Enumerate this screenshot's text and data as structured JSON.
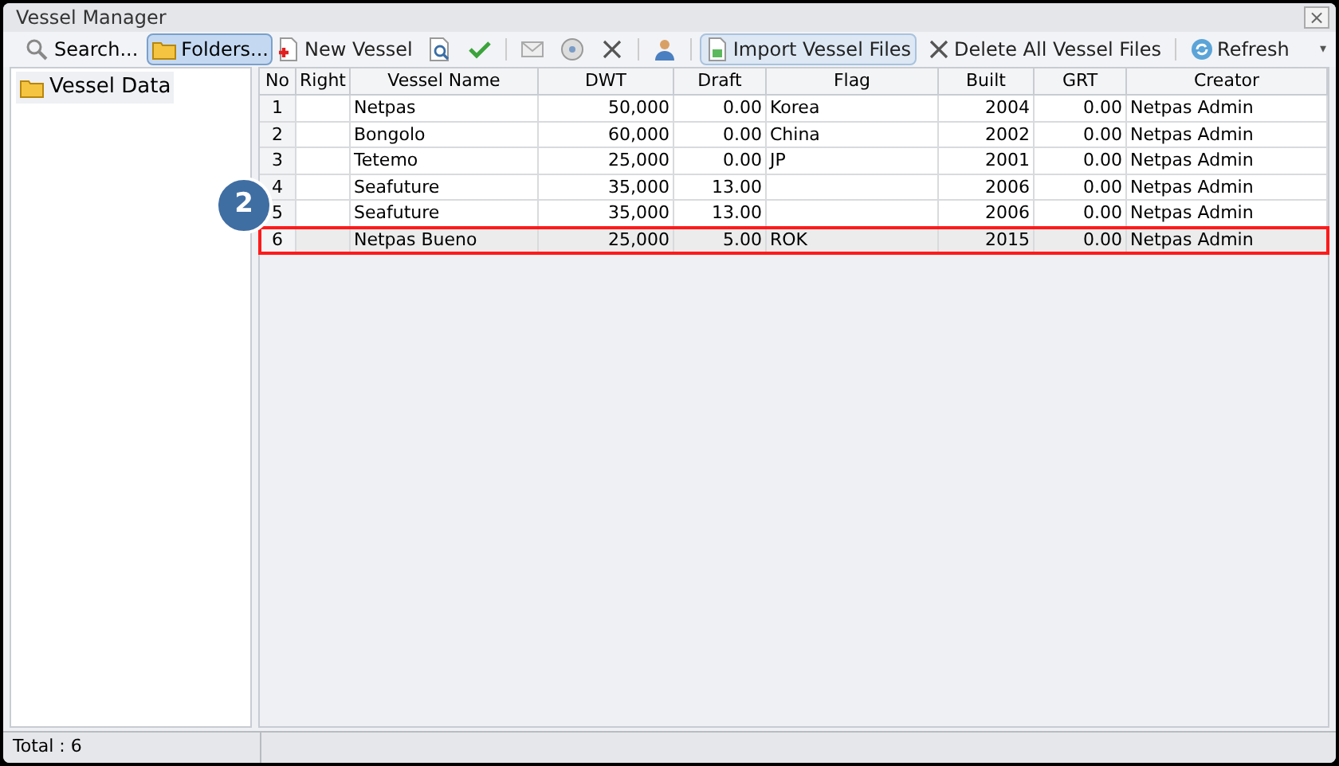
{
  "window": {
    "title": "Vessel Manager",
    "close": "×"
  },
  "left_toolbar": [
    {
      "label": "Search...",
      "selected": false
    },
    {
      "label": "Folders...",
      "selected": true
    }
  ],
  "toolbar": [
    {
      "kind": "button",
      "label": "New Vessel"
    },
    {
      "kind": "button"
    },
    {
      "kind": "button"
    },
    {
      "kind": "separator"
    },
    {
      "kind": "button"
    },
    {
      "kind": "button"
    },
    {
      "kind": "button"
    },
    {
      "kind": "separator"
    },
    {
      "kind": "button"
    },
    {
      "kind": "separator"
    },
    {
      "kind": "button",
      "label": "Import Vessel Files",
      "selected": true
    },
    {
      "kind": "button",
      "label": "Delete All Vessel Files"
    },
    {
      "kind": "separator"
    },
    {
      "kind": "button",
      "label": "Refresh"
    }
  ],
  "toolbar_overflow": "▾",
  "folders": [
    {
      "label": "Vessel Data",
      "selected": true
    }
  ],
  "table": {
    "columns": [
      "No",
      "Right",
      "Vessel Name",
      "DWT",
      "Draft",
      "Flag",
      "Built",
      "GRT",
      "Creator"
    ],
    "rows": [
      {
        "cells": [
          "1",
          "",
          "Netpas",
          "50,000",
          "0.00",
          "Korea",
          "2004",
          "0.00",
          "Netpas Admin"
        ],
        "selected": false
      },
      {
        "cells": [
          "2",
          "",
          "Bongolo",
          "60,000",
          "0.00",
          "China",
          "2002",
          "0.00",
          "Netpas Admin"
        ],
        "selected": false
      },
      {
        "cells": [
          "3",
          "",
          "Tetemo",
          "25,000",
          "0.00",
          "JP",
          "2001",
          "0.00",
          "Netpas Admin"
        ],
        "selected": false
      },
      {
        "cells": [
          "4",
          "",
          "Seafuture",
          "35,000",
          "13.00",
          "",
          "2006",
          "0.00",
          "Netpas Admin"
        ],
        "selected": false
      },
      {
        "cells": [
          "5",
          "",
          "Seafuture",
          "35,000",
          "13.00",
          "",
          "2006",
          "0.00",
          "Netpas Admin"
        ],
        "selected": false
      },
      {
        "cells": [
          "6",
          "",
          "Netpas Bueno",
          "25,000",
          "5.00",
          "ROK",
          "2015",
          "0.00",
          "Netpas Admin"
        ],
        "selected": true
      }
    ]
  },
  "callout": {
    "label": "2"
  },
  "status_bar": {
    "total": "Total : 6"
  }
}
